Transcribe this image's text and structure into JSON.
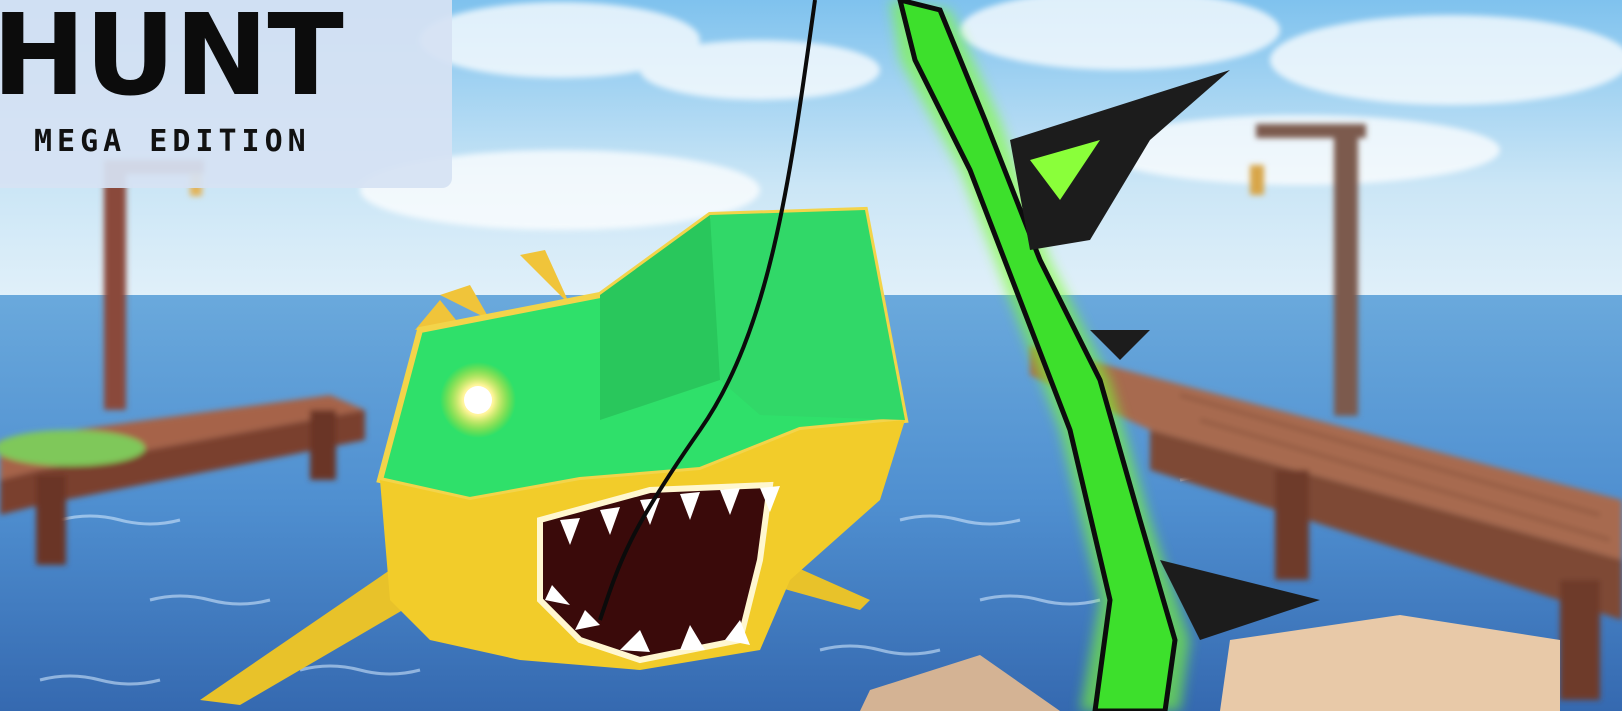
{
  "title_card": {
    "title": "HUNT",
    "subtitle": "MEGA EDITION"
  },
  "scene": {
    "creature": "green-and-yellow sea monster",
    "weapon": "green glowing spear",
    "accent_colors": {
      "monster_green": "#2fe06a",
      "monster_yellow": "#f2cc2a",
      "spear_glow": "#7dff2e",
      "water": "#3d7fc8",
      "sky": "#bfe0f5",
      "dock_wood": "#9a5a3c"
    }
  }
}
